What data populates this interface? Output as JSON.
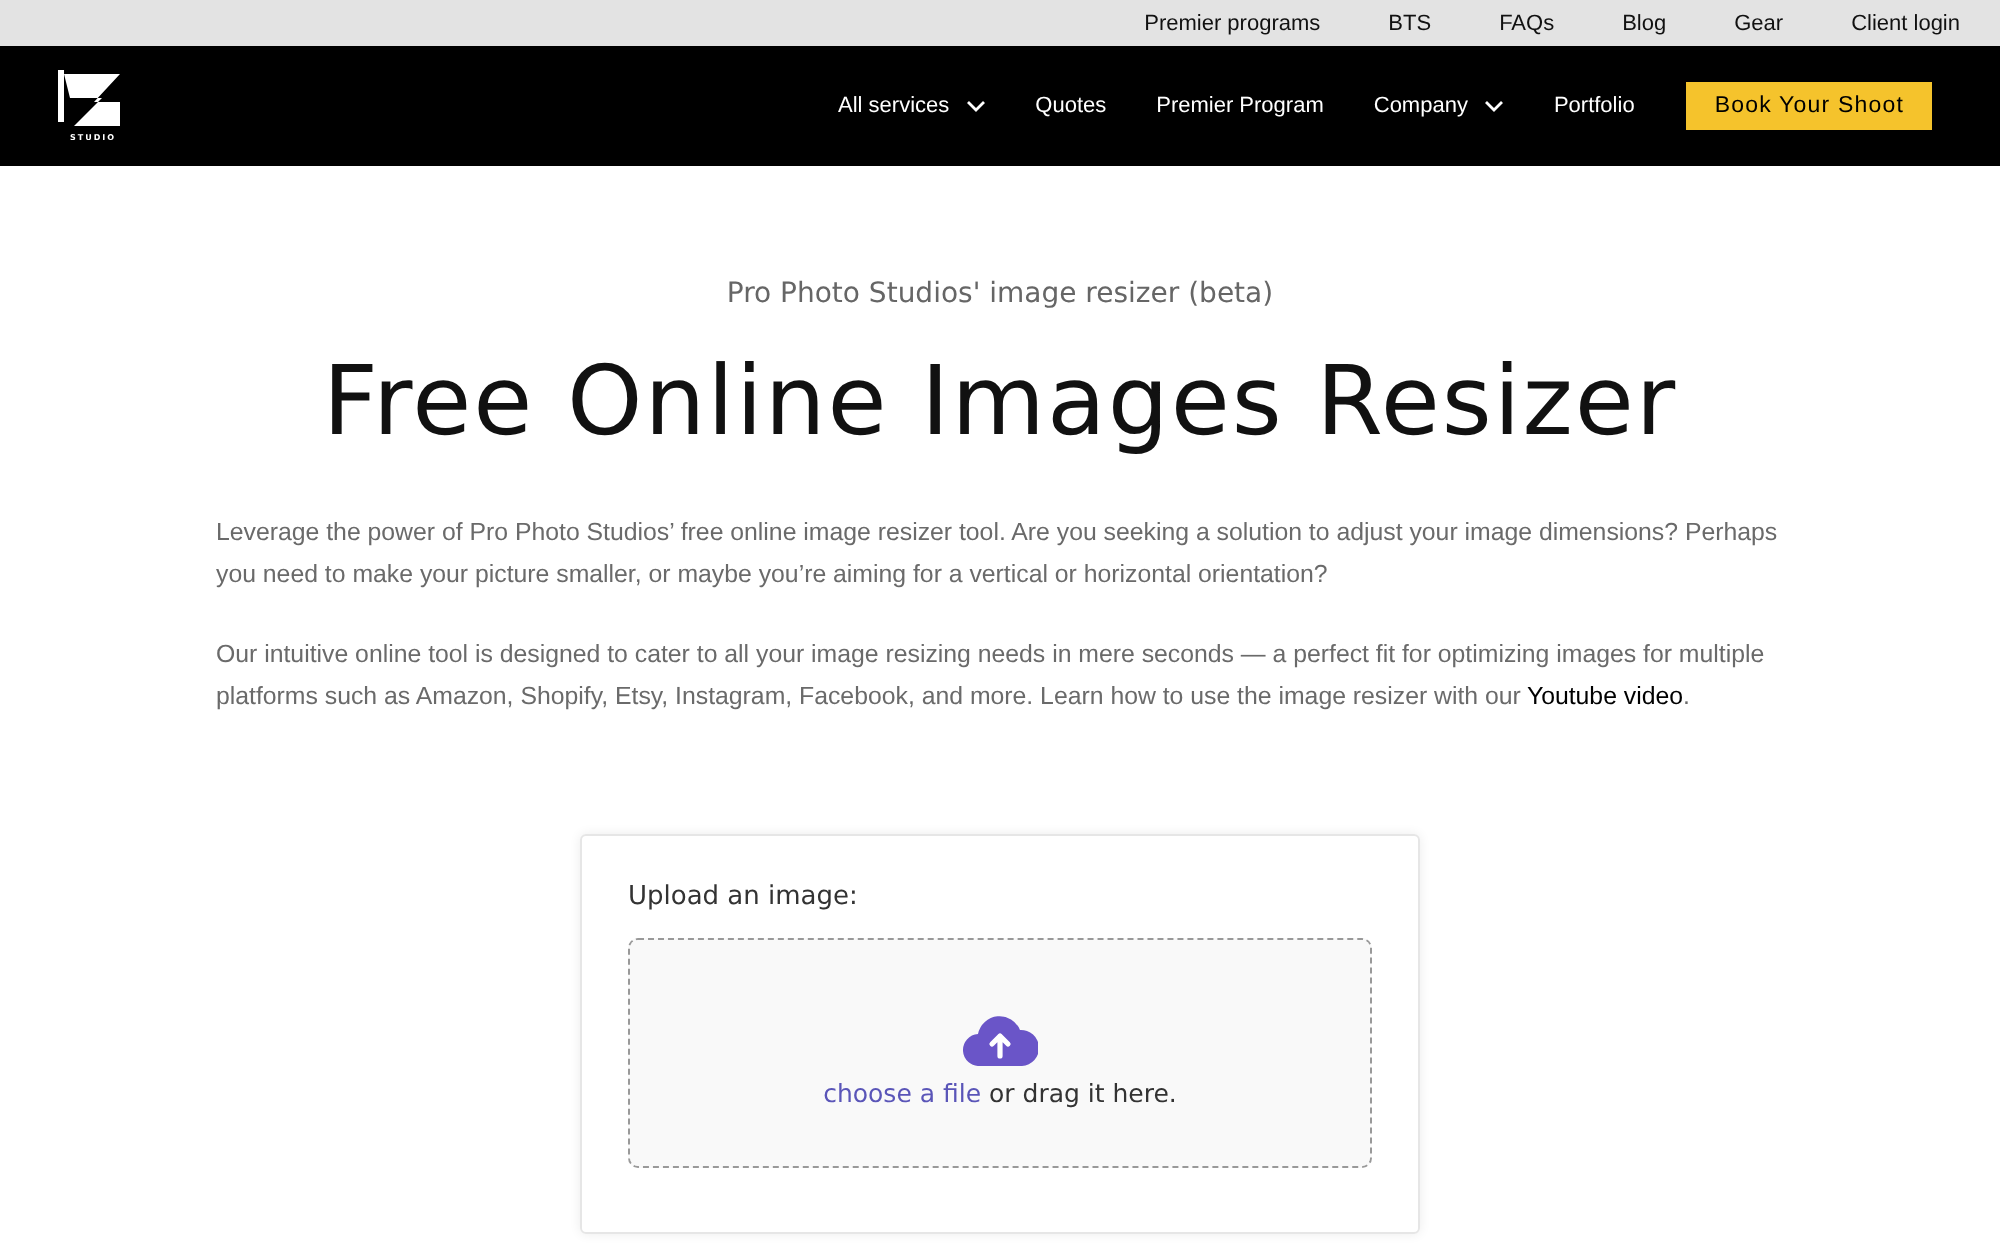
{
  "top_links": [
    "Premier programs",
    "BTS",
    "FAQs",
    "Blog",
    "Gear",
    "Client login"
  ],
  "logo": {
    "text": "STUDIO"
  },
  "nav": [
    {
      "label": "All services",
      "dropdown": true
    },
    {
      "label": "Quotes",
      "dropdown": false
    },
    {
      "label": "Premier Program",
      "dropdown": false
    },
    {
      "label": "Company",
      "dropdown": true
    },
    {
      "label": "Portfolio",
      "dropdown": false
    }
  ],
  "cta": "Book Your Shoot",
  "subtitle": "Pro Photo Studios' image resizer (beta)",
  "title": "Free Online Images Resizer",
  "paragraphs": [
    {
      "text": "Leverage the power of Pro Photo Studios’ free online image resizer tool. Are you seeking a solution to adjust your image dimensions? Perhaps you need to make your picture smaller, or maybe you’re aiming for a vertical or horizontal orientation?"
    },
    {
      "text": "Our intuitive online tool is designed to cater to all your image resizing needs in mere seconds — a perfect fit for optimizing images for multiple platforms such as Amazon, Shopify, Etsy, Instagram, Facebook, and more.  Learn how to use the image resizer with our",
      "link": "Youtube video",
      "after": "."
    }
  ],
  "upload": {
    "label": "Upload an image:",
    "link": "choose a file",
    "rest": "or drag it here."
  }
}
